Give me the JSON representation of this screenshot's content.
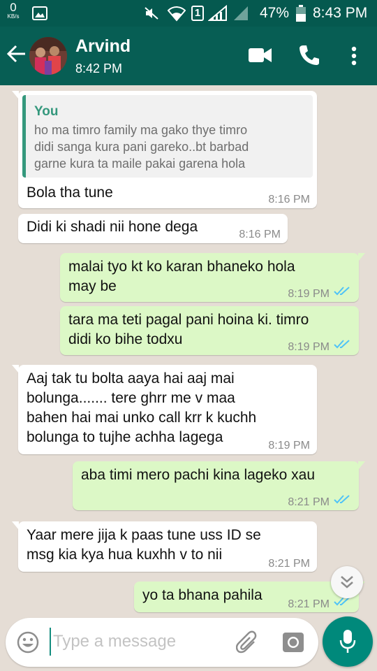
{
  "status_bar": {
    "data_speed_value": "0",
    "data_speed_unit": "KB/s",
    "battery": "47%",
    "time": "8:43 PM",
    "sim_slot": "1"
  },
  "header": {
    "contact_name": "Arvind",
    "contact_status": "8:42 PM"
  },
  "messages": [
    {
      "direction": "in",
      "quoted": {
        "author": "You",
        "text": "ho ma timro family ma gako thye timro\ndidi sanga kura pani gareko..bt barbad\ngarne kura ta maile pakai garena hola"
      },
      "text": "Bola tha tune",
      "time": "8:16 PM"
    },
    {
      "direction": "in",
      "text": "Didi ki shadi nii hone dega",
      "time": "8:16 PM"
    },
    {
      "direction": "out",
      "text": "malai tyo kt ko karan bhaneko hola\nmay be",
      "time": "8:19 PM",
      "status": "read"
    },
    {
      "direction": "out",
      "text": "tara ma teti pagal pani hoina ki. timro\ndidi ko bihe todxu",
      "time": "8:19 PM",
      "status": "read"
    },
    {
      "direction": "in",
      "text": "Aaj tak tu bolta aaya hai aaj mai\nbolunga....... tere ghrr me v maa\nbahen hai mai unko call krr k kuchh\nbolunga to tujhe achha lagega",
      "time": "8:19 PM"
    },
    {
      "direction": "out",
      "text": "aba timi mero pachi kina lageko xau",
      "time": "8:21 PM",
      "status": "read"
    },
    {
      "direction": "in",
      "text": "Yaar mere jija k paas tune uss ID se\nmsg kia kya hua kuxhh v to nii",
      "time": "8:21 PM"
    },
    {
      "direction": "out",
      "text": "yo ta bhana pahila",
      "time": "8:21 PM",
      "status": "read"
    }
  ],
  "input": {
    "placeholder": "Type a message"
  },
  "icons": {
    "back": "arrow-back-icon",
    "video": "video-call-icon",
    "call": "phone-call-icon",
    "menu": "more-vert-icon",
    "emoji": "emoji-icon",
    "attach": "attachment-icon",
    "camera": "camera-icon",
    "mic": "mic-icon",
    "scroll": "chevron-double-down-icon"
  },
  "colors": {
    "header": "#075e54",
    "status_bar": "#05594f",
    "chat_background": "#e5ddd5",
    "outgoing_bubble": "#dcf8c6",
    "incoming_bubble": "#ffffff",
    "read_ticks": "#4fc3f7",
    "accent": "#00897b",
    "quote_accent": "#35987d"
  }
}
